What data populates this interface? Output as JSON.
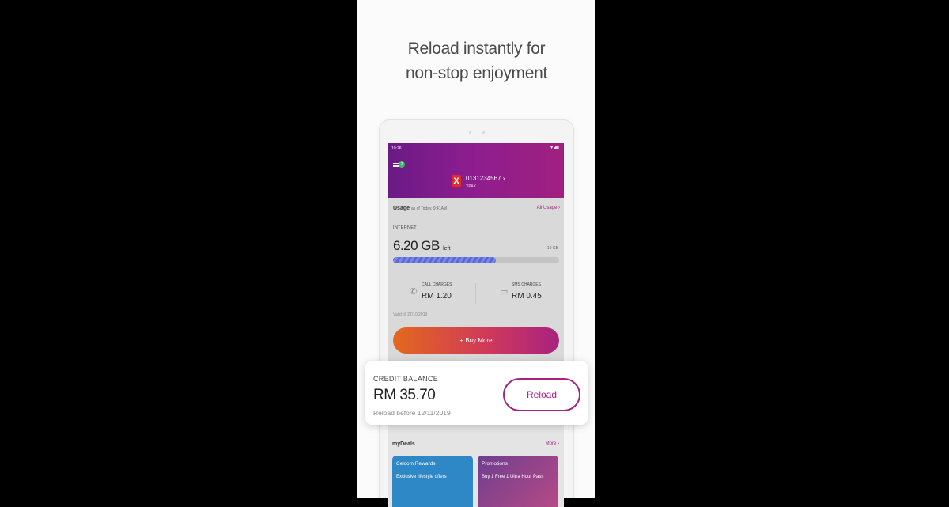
{
  "headline": {
    "line1": "Reload instantly for",
    "line2": "non-stop enjoyment"
  },
  "status_bar": {
    "time": "10:26",
    "icons": "▾◢▮"
  },
  "header": {
    "phone_number": "0131234567 ›",
    "plan": "XPAX",
    "menu_badge": "2",
    "logo_letter": "X"
  },
  "usage": {
    "title": "Usage",
    "as_of": "as of Today, 9:41AM",
    "all_usage_link": "All Usage ›",
    "internet_label": "INTERNET",
    "data_left": "6.20 GB",
    "data_left_suffix": "left",
    "data_total": "10 GB",
    "data_fraction_left": 0.62,
    "call_label": "CALL CHARGES",
    "call_value": "RM 1.20",
    "sms_label": "SMS CHARGES",
    "sms_value": "RM 0.45",
    "valid_till": "Valid till 27/10/2019"
  },
  "buy_more": {
    "label": "+ Buy More"
  },
  "credit": {
    "label": "CREDIT BALANCE",
    "amount": "RM 35.70",
    "note": "Reload before 12/11/2019",
    "reload_label": "Reload"
  },
  "deals": {
    "title": "myDeals",
    "more_link": "More ›",
    "cards": [
      {
        "title": "Celcom Rewards",
        "desc": "Exclusive lifestyle offers",
        "color": "#2f88c6"
      },
      {
        "title": "Promotions",
        "desc": "Buy 1 Free 1 Ultra Hour Pass",
        "color": "#6f3e8f"
      }
    ]
  },
  "colors": {
    "brand_purple": "#8c1d8f",
    "accent_magenta": "#a8227f",
    "orange": "#e3691c"
  }
}
